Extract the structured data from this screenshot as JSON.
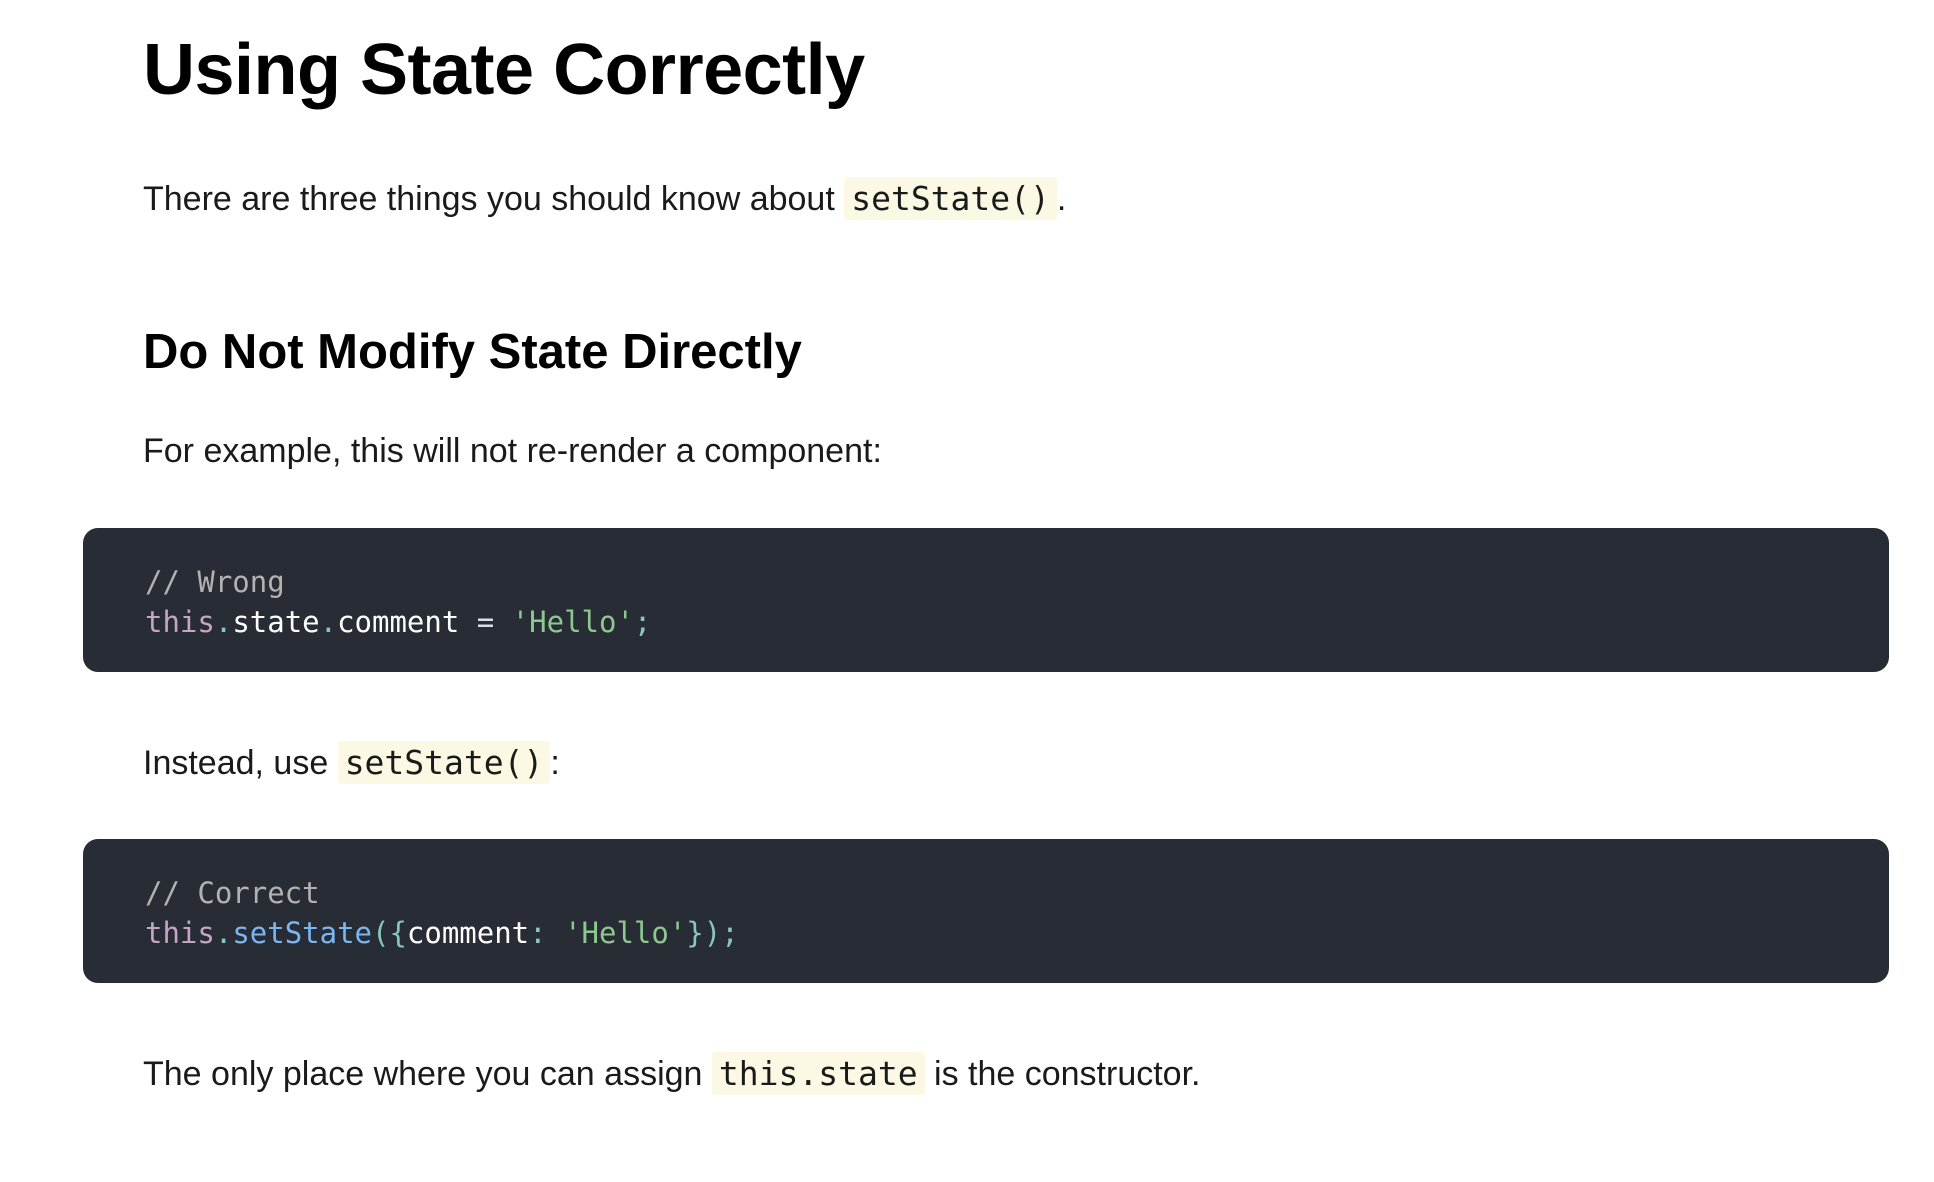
{
  "heading": "Using State Correctly",
  "intro": {
    "before": "There are three things you should know about ",
    "code": "setState()",
    "after": "."
  },
  "subheading": "Do Not Modify State Directly",
  "example_text": "For example, this will not re-render a component:",
  "code_wrong": {
    "comment": "// Wrong",
    "t1": "this",
    "t2": ".",
    "t3": "state",
    "t4": ".",
    "t5": "comment",
    "t6": " = ",
    "t7": "'Hello'",
    "t8": ";"
  },
  "instead": {
    "before": "Instead, use ",
    "code": "setState()",
    "after": ":"
  },
  "code_correct": {
    "comment": "// Correct",
    "t1": "this",
    "t2": ".",
    "t3": "setState",
    "t4": "({",
    "t5": "comment",
    "t6": ": ",
    "t7": "'Hello'",
    "t8": "});"
  },
  "closing": {
    "before": "The only place where you can assign ",
    "code": "this.state",
    "after": " is the constructor."
  }
}
